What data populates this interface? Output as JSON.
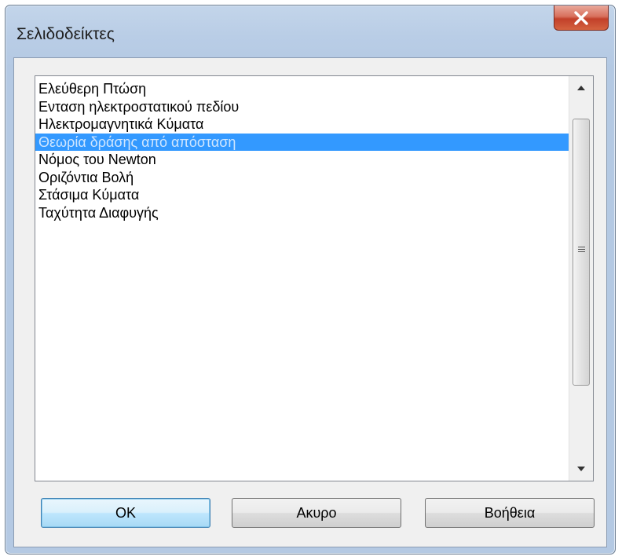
{
  "window": {
    "title": "Σελιδοδείκτες",
    "close_label": "X"
  },
  "bookmarks": {
    "items": [
      {
        "label": "Ελεύθερη Πτώση"
      },
      {
        "label": "Ενταση ηλεκτροστατικού πεδίου"
      },
      {
        "label": "Ηλεκτρομαγνητικά Κύματα"
      },
      {
        "label": "Θεωρία δράσης από απόσταση"
      },
      {
        "label": "Νόμος του Newton"
      },
      {
        "label": "Οριζόντια Βολή"
      },
      {
        "label": "Στάσιμα Κύματα"
      },
      {
        "label": "Ταχύτητα Διαφυγής"
      }
    ],
    "selected_index": 3
  },
  "buttons": {
    "ok": "OK",
    "cancel": "Ακυρο",
    "help": "Βοήθεια"
  },
  "icons": {
    "close": "close-icon",
    "scroll_up": "scroll-up-arrow-icon",
    "scroll_down": "scroll-down-arrow-icon",
    "grip": "scroll-grip-icon"
  }
}
